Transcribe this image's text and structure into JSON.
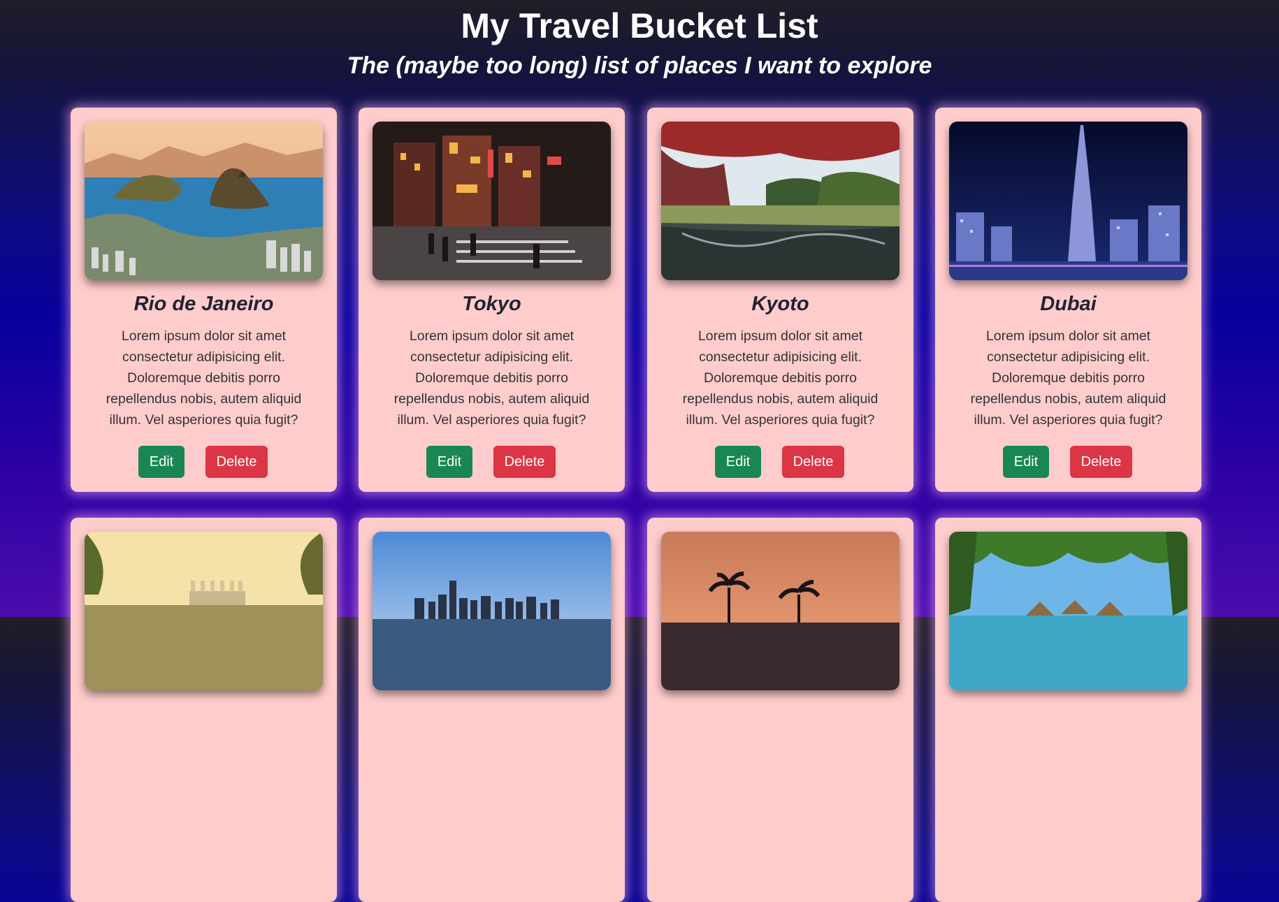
{
  "header": {
    "title": "My Travel Bucket List",
    "subtitle": "The (maybe too long) list of places I want to explore"
  },
  "cards": [
    {
      "name": "Rio de Janeiro",
      "description": "Lorem ipsum dolor sit amet consectetur adipisicing elit. Doloremque debitis porro repellendus nobis, autem aliquid illum. Vel asperiores quia fugit?",
      "edit_label": "Edit",
      "delete_label": "Delete"
    },
    {
      "name": "Tokyo",
      "description": "Lorem ipsum dolor sit amet consectetur adipisicing elit. Doloremque debitis porro repellendus nobis, autem aliquid illum. Vel asperiores quia fugit?",
      "edit_label": "Edit",
      "delete_label": "Delete"
    },
    {
      "name": "Kyoto",
      "description": "Lorem ipsum dolor sit amet consectetur adipisicing elit. Doloremque debitis porro repellendus nobis, autem aliquid illum. Vel asperiores quia fugit?",
      "edit_label": "Edit",
      "delete_label": "Delete"
    },
    {
      "name": "Dubai",
      "description": "Lorem ipsum dolor sit amet consectetur adipisicing elit. Doloremque debitis porro repellendus nobis, autem aliquid illum. Vel asperiores quia fugit?",
      "edit_label": "Edit",
      "delete_label": "Delete"
    }
  ],
  "colors": {
    "card_background": "#ffcccc",
    "edit_button": "#198754",
    "delete_button": "#dc3545",
    "title_text": "#ffffff"
  }
}
